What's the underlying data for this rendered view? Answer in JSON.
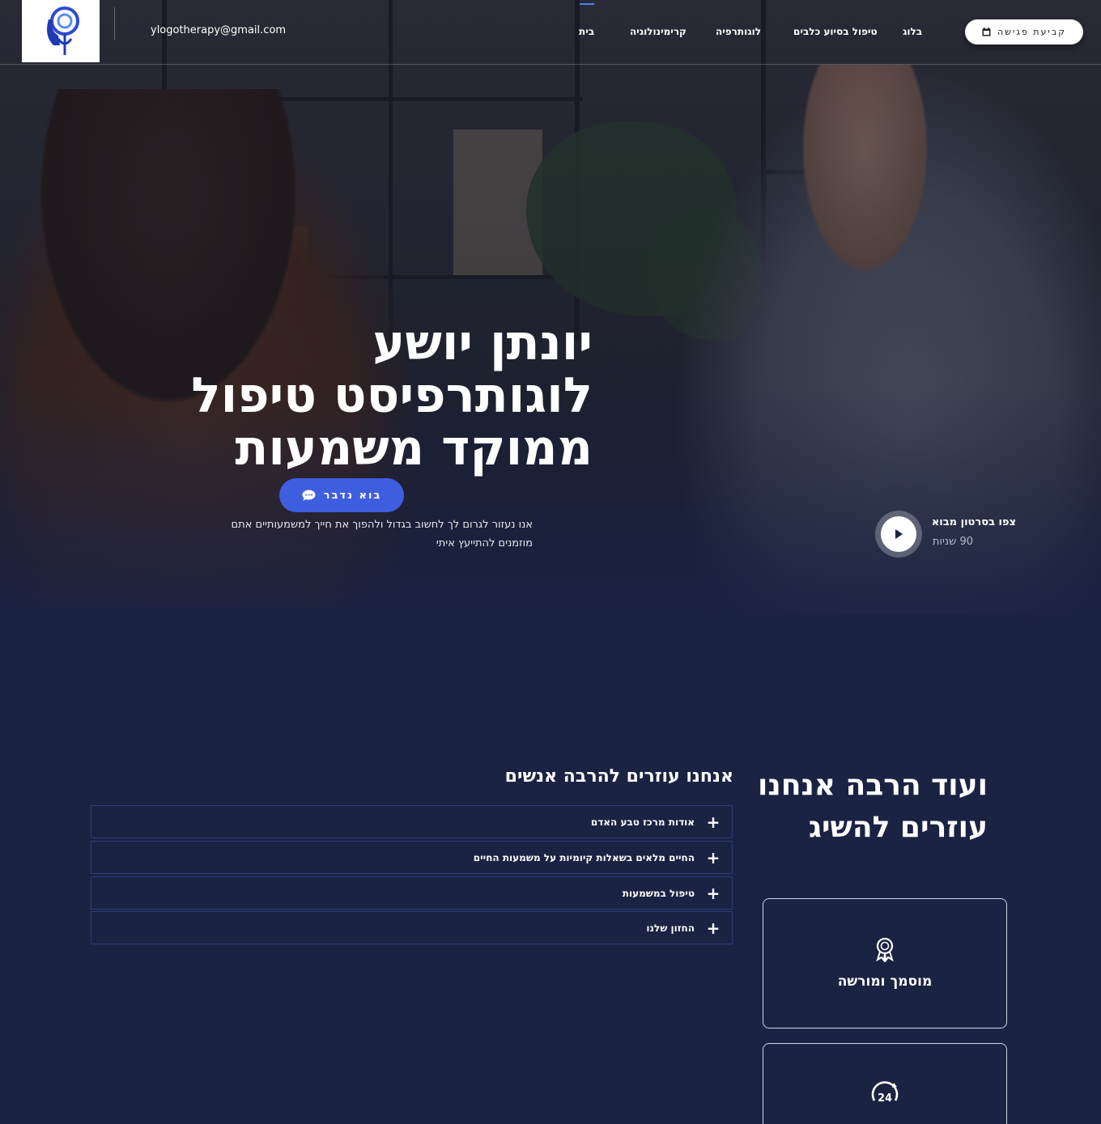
{
  "header": {
    "email": "ylogotherapy@gmail.com",
    "nav": [
      {
        "label": "בית"
      },
      {
        "label": "קרימינולוגיה"
      },
      {
        "label": "לוגותרפיה"
      },
      {
        "label": "טיפול בסיוע כלבים"
      },
      {
        "label": "בלוג"
      }
    ],
    "cta_label": "קביעת פגישה"
  },
  "hero": {
    "title_lines": [
      "יונתן יושע",
      "לוגותרפיסט טיפול",
      "ממוקד משמעות"
    ],
    "talk_button": "בוא נדבר",
    "subtitle_lines": [
      "אנו נעזור לגרום לך לחשוב בגדול ולהפוך את חייך למשמעותיים אתם",
      "מוזמנים להתייעץ איתי"
    ],
    "video_title": "צפו בסרטון מבוא",
    "video_duration": "90 שניות"
  },
  "help": {
    "title": "אנחנו עוזרים להרבה אנשים",
    "items": [
      {
        "label": "אודות מרכז טבע האדם"
      },
      {
        "label": "החיים מלאים בשאלות קיומיות על משמעות החיים"
      },
      {
        "label": "טיפול במשמעות"
      },
      {
        "label": "החזון שלנו"
      }
    ]
  },
  "more": {
    "title_lines": [
      "ועוד הרבה אנחנו",
      "עוזרים להשיג"
    ],
    "cards": [
      {
        "label": "מוסמך ומורשה",
        "icon": "award-icon"
      },
      {
        "label": "",
        "icon": "clock-24-icon",
        "icon_text": "24"
      }
    ]
  },
  "colors": {
    "accent": "#3e5ee0",
    "background": "#1b2343",
    "accordion_border": "#2e3c7a"
  }
}
